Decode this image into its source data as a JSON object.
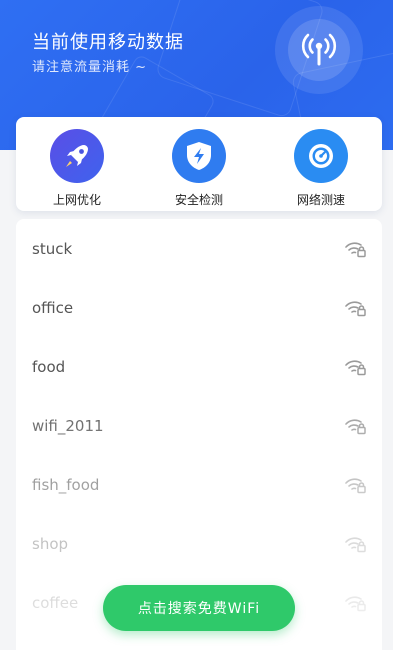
{
  "header": {
    "title": "当前使用移动数据",
    "subtitle": "请注意流量消耗 ~"
  },
  "tools": [
    {
      "label": "上网优化",
      "icon": "rocket-icon",
      "color": "#4a55e0"
    },
    {
      "label": "安全检测",
      "icon": "shield-lightning-icon",
      "color": "#2f7cf0"
    },
    {
      "label": "网络测速",
      "icon": "speedometer-icon",
      "color": "#2a8cf2"
    }
  ],
  "wifi_networks": [
    {
      "name": "stuck"
    },
    {
      "name": "office"
    },
    {
      "name": "food"
    },
    {
      "name": "wifi_2011"
    },
    {
      "name": "fish_food"
    },
    {
      "name": "shop"
    },
    {
      "name": "coffee"
    }
  ],
  "search_button": {
    "label": "点击搜索免费WiFi",
    "color": "#2fc96a"
  },
  "colors": {
    "header_blue": "#2f6ff3",
    "accent_green": "#2fc96a"
  }
}
